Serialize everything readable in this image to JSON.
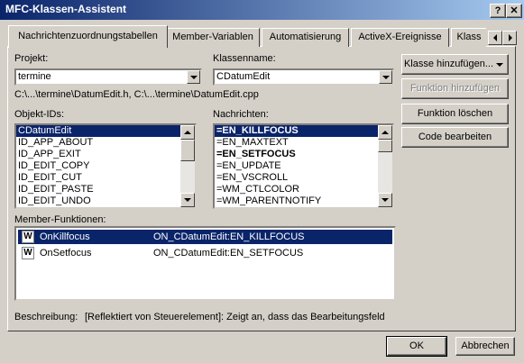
{
  "window": {
    "title": "MFC-Klassen-Assistent",
    "help_btn": "?",
    "close_btn": "✕"
  },
  "tabs": [
    {
      "label": "Nachrichtenzuordnungstabellen"
    },
    {
      "label": "Member-Variablen"
    },
    {
      "label": "Automatisierung"
    },
    {
      "label": "ActiveX-Ereignisse"
    },
    {
      "label": "Klass"
    }
  ],
  "project": {
    "label": "Projekt:",
    "value": "termine"
  },
  "classname": {
    "label": "Klassenname:",
    "value": "CDatumEdit"
  },
  "filepath": "C:\\...\\termine\\DatumEdit.h, C:\\...\\termine\\DatumEdit.cpp",
  "objects": {
    "label": "Objekt-IDs:",
    "items": [
      "CDatumEdit",
      "ID_APP_ABOUT",
      "ID_APP_EXIT",
      "ID_EDIT_COPY",
      "ID_EDIT_CUT",
      "ID_EDIT_PASTE",
      "ID_EDIT_UNDO"
    ]
  },
  "messages": {
    "label": "Nachrichten:",
    "items": [
      "=EN_KILLFOCUS",
      "=EN_MAXTEXT",
      "=EN_SETFOCUS",
      "=EN_UPDATE",
      "=EN_VSCROLL",
      "=WM_CTLCOLOR",
      "=WM_PARENTNOTIFY"
    ]
  },
  "buttons": {
    "add_class": "Klasse hinzufügen...",
    "add_function": "Funktion hinzufügen",
    "delete_function": "Funktion löschen",
    "edit_code": "Code bearbeiten"
  },
  "members": {
    "label": "Member-Funktionen:",
    "rows": [
      {
        "icon": "W",
        "name": "OnKillfocus",
        "mapping": "ON_CDatumEdit:EN_KILLFOCUS"
      },
      {
        "icon": "W",
        "name": "OnSetfocus",
        "mapping": "ON_CDatumEdit:EN_SETFOCUS"
      }
    ]
  },
  "description": {
    "label": "Beschreibung:",
    "text": "[Reflektiert von Steuerelement]: Zeigt an, dass das Bearbeitungsfeld"
  },
  "footer": {
    "ok": "OK",
    "cancel": "Abbrechen"
  }
}
